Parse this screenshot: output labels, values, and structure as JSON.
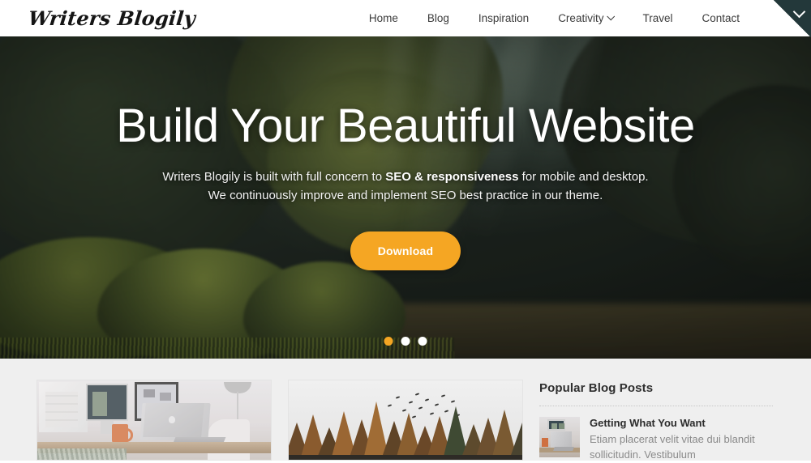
{
  "site": {
    "logo": "Writers Blogily"
  },
  "nav": {
    "items": [
      {
        "label": "Home",
        "has_dropdown": false
      },
      {
        "label": "Blog",
        "has_dropdown": false
      },
      {
        "label": "Inspiration",
        "has_dropdown": false
      },
      {
        "label": "Creativity",
        "has_dropdown": true
      },
      {
        "label": "Travel",
        "has_dropdown": false
      },
      {
        "label": "Contact",
        "has_dropdown": false
      }
    ],
    "corner_toggle_icon": "chevron-down-icon"
  },
  "hero": {
    "title": "Build Your Beautiful Website",
    "subtitle_line1_pre": "Writers Blogily is built with full concern to ",
    "subtitle_line1_bold": "SEO & responsiveness",
    "subtitle_line1_post": " for mobile and desktop.",
    "subtitle_line2": "We continuously improve and implement SEO best practice in our theme.",
    "cta_label": "Download",
    "carousel": {
      "total": 3,
      "active_index": 0,
      "active_color": "#f5a623",
      "inactive_color": "#ffffff"
    },
    "background_image": "dark-forest-sunbeams-photo"
  },
  "content": {
    "cards": [
      {
        "image": "desk-workspace-imac-macbook-photo"
      },
      {
        "image": "autumn-pine-forest-birds-photo"
      }
    ],
    "sidebar": {
      "title": "Popular Blog Posts",
      "posts": [
        {
          "thumb": "desk-workspace-thumbnail",
          "title": "Getting What You Want",
          "excerpt": "Etiam placerat velit vitae dui blandit sollicitudin. Vestibulum"
        }
      ]
    }
  },
  "colors": {
    "accent": "#f5a623",
    "nav_bg": "#ffffff",
    "nav_text": "#3b3b3b",
    "ribbon": "#23383a",
    "section_bg": "#efefef"
  }
}
